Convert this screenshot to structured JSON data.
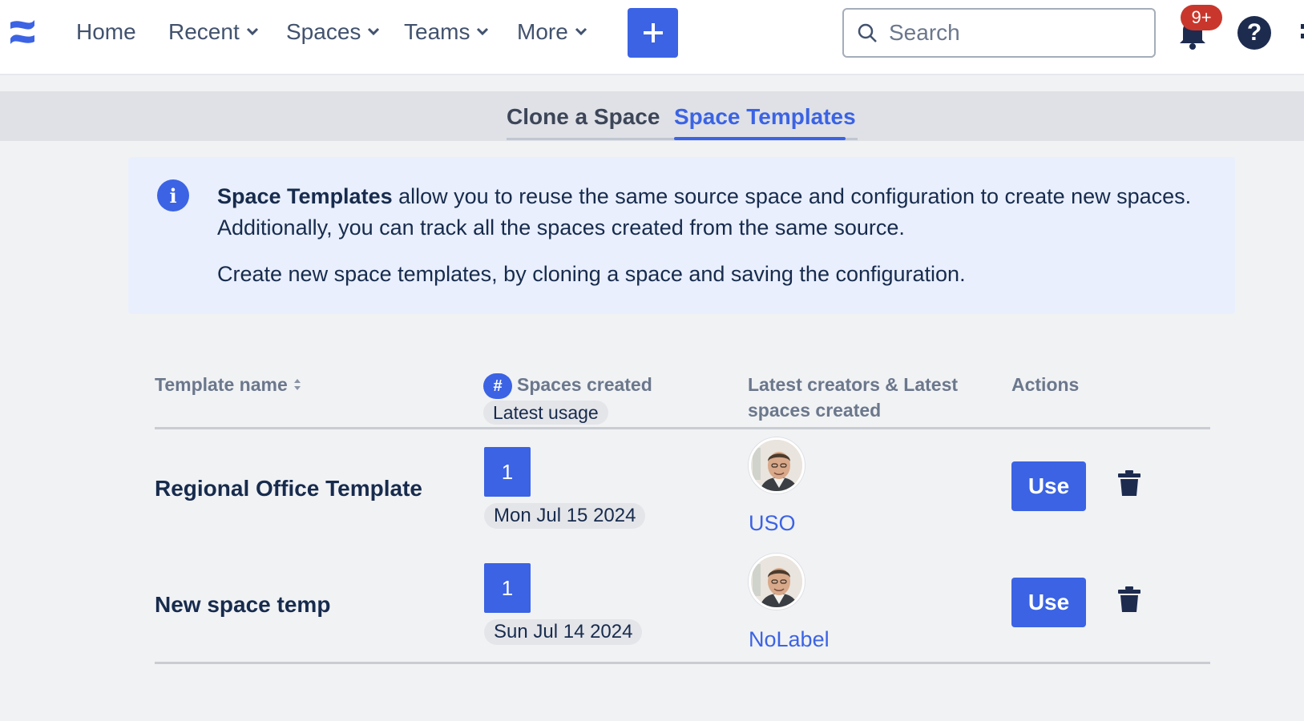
{
  "nav": {
    "logo_icon": "confluence-logo-icon",
    "items": [
      {
        "label": "Home",
        "has_dropdown": false
      },
      {
        "label": "Recent",
        "has_dropdown": true
      },
      {
        "label": "Spaces",
        "has_dropdown": true
      },
      {
        "label": "Teams",
        "has_dropdown": true
      },
      {
        "label": "More",
        "has_dropdown": true
      }
    ],
    "create_icon": "plus-icon",
    "search": {
      "placeholder": "Search",
      "icon": "search-icon"
    },
    "notifications": {
      "icon": "bell-icon",
      "badge": "9+"
    },
    "help": {
      "icon": "help-icon",
      "glyph": "?"
    }
  },
  "tabs": [
    {
      "label": "Clone a Space",
      "active": false
    },
    {
      "label": "Space Templates",
      "active": true
    }
  ],
  "info": {
    "icon": "info-icon",
    "icon_glyph": "i",
    "strong": "Space Templates",
    "line1_rest": " allow you to reuse the same source space and configuration to create new spaces. Additionally, you can track all the spaces created from the same source.",
    "line2": "Create new space templates, by cloning a space and saving the configuration."
  },
  "table": {
    "headers": {
      "name": "Template name",
      "hash": "#",
      "spaces_created": "Spaces created",
      "latest_usage": "Latest usage",
      "creators": "Latest creators & Latest spaces created",
      "actions": "Actions"
    },
    "rows": [
      {
        "name": "Regional Office Template",
        "count": "1",
        "date": "Mon Jul 15 2024",
        "space": "USO",
        "action": "Use"
      },
      {
        "name": "New space temp",
        "count": "1",
        "date": "Sun Jul 14 2024",
        "space": "NoLabel",
        "action": "Use"
      }
    ]
  },
  "colors": {
    "accent": "#3b63e4",
    "badge": "#c9372c",
    "text": "#172b4d",
    "info_bg": "#e9effc"
  }
}
